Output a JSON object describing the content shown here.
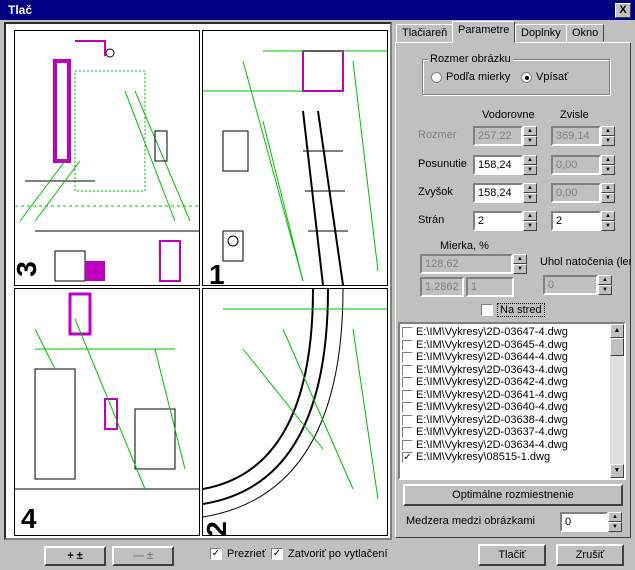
{
  "window": {
    "title": "Tlač",
    "close_label": "X"
  },
  "preview": {
    "page_numbers": [
      "3",
      "1",
      "4",
      "2"
    ]
  },
  "tabs": [
    "Tlačiareň",
    "Parametre",
    "Doplnky",
    "Okno"
  ],
  "image_size": {
    "legend": "Rozmer obrázku",
    "option_scale": "Podľa mierky",
    "option_fit": "Vpísať",
    "selected": "Vpísať"
  },
  "columns": {
    "horizontal": "Vodorovne",
    "vertical": "Zvisle"
  },
  "rows": [
    {
      "label": "Rozmer",
      "h": "257,22",
      "v": "369,14",
      "h_enabled": false,
      "v_enabled": false
    },
    {
      "label": "Posunutie",
      "h": "158,24",
      "v": "0,00",
      "h_enabled": true,
      "v_enabled": false
    },
    {
      "label": "Zvyšok",
      "h": "158,24",
      "v": "0,00",
      "h_enabled": true,
      "v_enabled": false
    },
    {
      "label": "Strán",
      "h": "2",
      "v": "2",
      "h_enabled": true,
      "v_enabled": true
    }
  ],
  "scale": {
    "label": "Mierka, %",
    "value": "128,62",
    "ratio_a": "1.2862",
    "ratio_b": "1"
  },
  "rotation": {
    "label": "Uhol natočenia (len",
    "value": "0"
  },
  "center": {
    "label": "Na stred",
    "checked": false
  },
  "files": [
    {
      "path": "E:\\IM\\Vykresy\\2D-03647-4.dwg",
      "checked": false
    },
    {
      "path": "E:\\IM\\Vykresy\\2D-03645-4.dwg",
      "checked": false
    },
    {
      "path": "E:\\IM\\Vykresy\\2D-03644-4.dwg",
      "checked": false
    },
    {
      "path": "E:\\IM\\Vykresy\\2D-03643-4.dwg",
      "checked": false
    },
    {
      "path": "E:\\IM\\Vykresy\\2D-03642-4.dwg",
      "checked": false
    },
    {
      "path": "E:\\IM\\Vykresy\\2D-03641-4.dwg",
      "checked": false
    },
    {
      "path": "E:\\IM\\Vykresy\\2D-03640-4.dwg",
      "checked": false
    },
    {
      "path": "E:\\IM\\Vykresy\\2D-03638-4.dwg",
      "checked": false
    },
    {
      "path": "E:\\IM\\Vykresy\\2D-03637-4.dwg",
      "checked": false
    },
    {
      "path": "E:\\IM\\Vykresy\\2D-03634-4.dwg",
      "checked": false
    },
    {
      "path": "E:\\IM\\Vykresy\\08515-1.dwg",
      "checked": true
    }
  ],
  "optimal_button": "Optimálne rozmiestnenie",
  "spacing": {
    "label": "Medzera medzi obrázkami",
    "value": "0"
  },
  "bottom": {
    "zoom_in": "+ ±",
    "zoom_out": "— ±",
    "preview_check": "Prezrieť",
    "preview_checked": true,
    "close_after_check": "Zatvoriť po vytlačení",
    "close_after_checked": true,
    "print_button": "Tlačiť",
    "cancel_button": "Zrušiť"
  },
  "colors": {
    "title_bar": "#000080",
    "drawing_green": "#00c000",
    "drawing_magenta": "#c000c0",
    "face": "#c0c0c0"
  }
}
